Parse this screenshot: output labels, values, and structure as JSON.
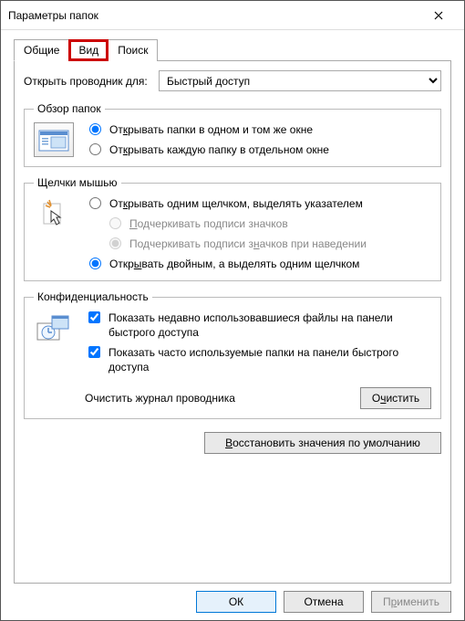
{
  "window": {
    "title": "Параметры папок"
  },
  "tabs": {
    "general": "Общие",
    "view": "Вид",
    "search": "Поиск"
  },
  "open_in": {
    "label": "Открыть проводник для:",
    "selected": "Быстрый доступ"
  },
  "browse": {
    "legend": "Обзор папок",
    "same": "Открывать папки в одном и том же окне",
    "same_u": "к",
    "sep": "Открывать каждую папку в отдельном окне",
    "sep_u": "к"
  },
  "click": {
    "legend": "Щелчки мышью",
    "single": "Открывать одним щелчком, выделять указателем",
    "single_u": "к",
    "under_always": "Подчеркивать подписи значков",
    "under_always_u": "П",
    "under_hover": "Подчеркивать подписи значков при наведении",
    "under_hover_u": "н",
    "double": "Открывать двойным, а выделять одним щелчком",
    "double_u": "ы"
  },
  "privacy": {
    "legend": "Конфиденциальность",
    "recent": "Показать недавно использовавшиеся файлы на панели быстрого доступа",
    "frequent": "Показать часто используемые папки на панели быстрого доступа",
    "clear_label": "Очистить журнал проводника",
    "clear_btn": "Очистить",
    "clear_btn_u": "ч"
  },
  "restore": {
    "label": "Восстановить значения по умолчанию",
    "u": "В"
  },
  "buttons": {
    "ok": "ОК",
    "cancel": "Отмена",
    "apply": "Применить",
    "apply_u": "р"
  }
}
